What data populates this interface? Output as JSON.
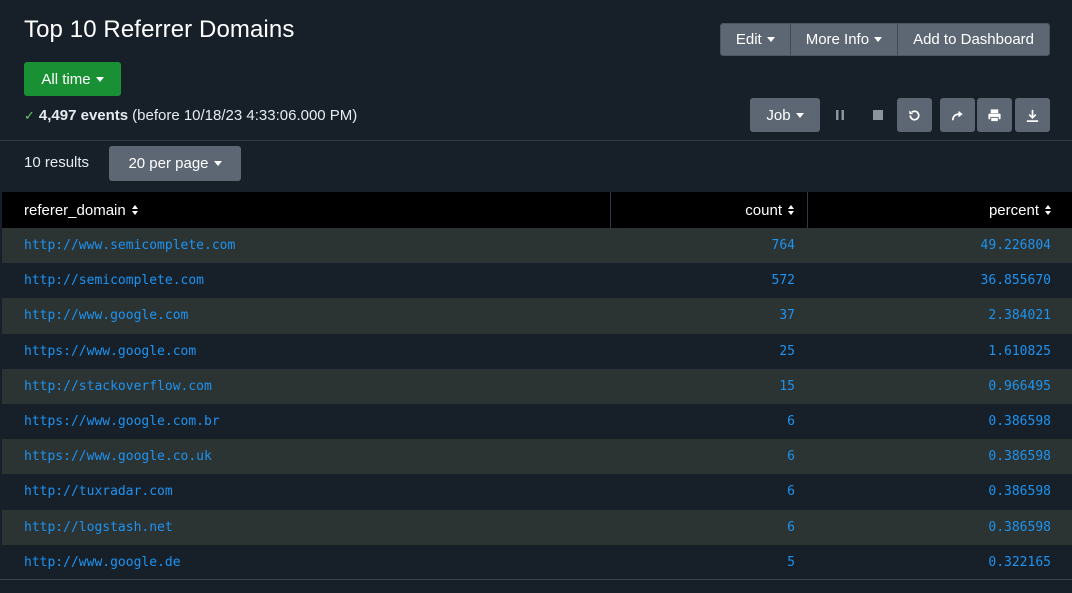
{
  "header": {
    "title": "Top 10 Referrer Domains",
    "actions": {
      "edit": "Edit",
      "more_info": "More Info",
      "add_dashboard": "Add to Dashboard"
    },
    "time_picker": "All time"
  },
  "status": {
    "event_count": "4,497 events",
    "before_text": "(before 10/18/23 4:33:06.000 PM)"
  },
  "job": {
    "label": "Job"
  },
  "results": {
    "count_label": "10 results",
    "per_page": "20 per page"
  },
  "table": {
    "columns": [
      "referer_domain",
      "count",
      "percent"
    ],
    "rows": [
      {
        "referer_domain": "http://www.semicomplete.com",
        "count": "764",
        "percent": "49.226804"
      },
      {
        "referer_domain": "http://semicomplete.com",
        "count": "572",
        "percent": "36.855670"
      },
      {
        "referer_domain": "http://www.google.com",
        "count": "37",
        "percent": "2.384021"
      },
      {
        "referer_domain": "https://www.google.com",
        "count": "25",
        "percent": "1.610825"
      },
      {
        "referer_domain": "http://stackoverflow.com",
        "count": "15",
        "percent": "0.966495"
      },
      {
        "referer_domain": "https://www.google.com.br",
        "count": "6",
        "percent": "0.386598"
      },
      {
        "referer_domain": "https://www.google.co.uk",
        "count": "6",
        "percent": "0.386598"
      },
      {
        "referer_domain": "http://tuxradar.com",
        "count": "6",
        "percent": "0.386598"
      },
      {
        "referer_domain": "http://logstash.net",
        "count": "6",
        "percent": "0.386598"
      },
      {
        "referer_domain": "http://www.google.de",
        "count": "5",
        "percent": "0.322165"
      }
    ]
  },
  "colors": {
    "background": "#172029",
    "link": "#1e93f0",
    "time_button": "#1a9035",
    "button": "#5c6773"
  }
}
